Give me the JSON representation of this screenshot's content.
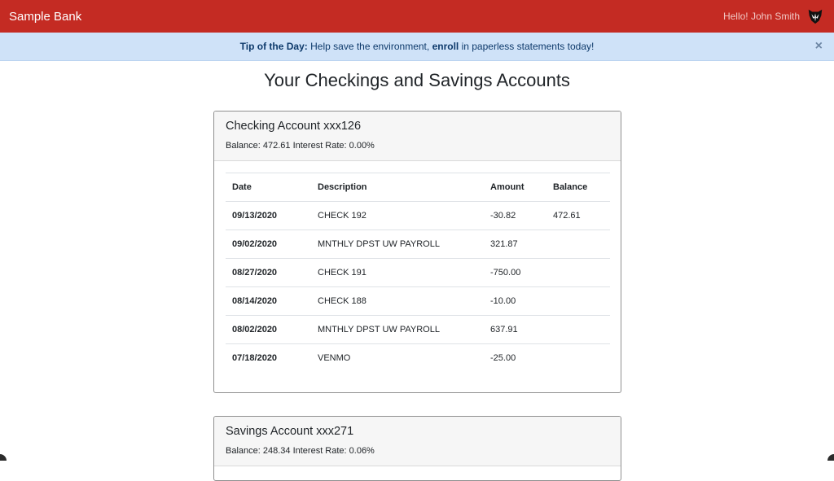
{
  "navbar": {
    "brand": "Sample Bank",
    "greeting": "Hello! John Smith",
    "logo_icon": "badger-icon",
    "background": "#c42b23"
  },
  "alert": {
    "prefix": "Tip of the Day:",
    "text1": "Help save the environment,",
    "link": "enroll",
    "text2": "in paperless statements today!",
    "close": "×"
  },
  "page": {
    "title": "Your Checkings and Savings Accounts"
  },
  "accounts": [
    {
      "title": "Checking Account xxx126",
      "summary": "Balance: 472.61 Interest Rate: 0.00%",
      "columns": [
        "Date",
        "Description",
        "Amount",
        "Balance"
      ],
      "rows": [
        {
          "date": "09/13/2020",
          "description": "CHECK 192",
          "amount": "-30.82",
          "balance": "472.61"
        },
        {
          "date": "09/02/2020",
          "description": "MNTHLY DPST UW PAYROLL",
          "amount": "321.87",
          "balance": ""
        },
        {
          "date": "08/27/2020",
          "description": "CHECK 191",
          "amount": "-750.00",
          "balance": ""
        },
        {
          "date": "08/14/2020",
          "description": "CHECK 188",
          "amount": "-10.00",
          "balance": ""
        },
        {
          "date": "08/02/2020",
          "description": "MNTHLY DPST UW PAYROLL",
          "amount": "637.91",
          "balance": ""
        },
        {
          "date": "07/18/2020",
          "description": "VENMO",
          "amount": "-25.00",
          "balance": ""
        }
      ]
    },
    {
      "title": "Savings Account xxx271",
      "summary": "Balance: 248.34 Interest Rate: 0.06%"
    }
  ]
}
